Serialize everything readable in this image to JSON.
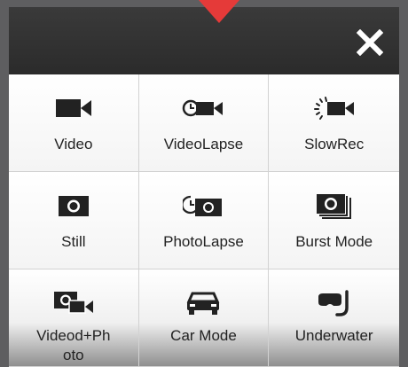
{
  "menu": {
    "close_icon": "close-icon",
    "modes": [
      {
        "id": "video",
        "label": "Video",
        "icon": "video-camera-icon"
      },
      {
        "id": "videolapse",
        "label": "VideoLapse",
        "icon": "videolapse-icon"
      },
      {
        "id": "slowrec",
        "label": "SlowRec",
        "icon": "slow-motion-icon"
      },
      {
        "id": "still",
        "label": "Still",
        "icon": "photo-camera-icon"
      },
      {
        "id": "photolapse",
        "label": "PhotoLapse",
        "icon": "photolapse-icon"
      },
      {
        "id": "burst",
        "label": "Burst Mode",
        "icon": "burst-camera-icon"
      },
      {
        "id": "videophoto",
        "label": "Videod+Ph\noto",
        "icon": "video-photo-icon"
      },
      {
        "id": "carmode",
        "label": "Car Mode",
        "icon": "car-icon"
      },
      {
        "id": "underwater",
        "label": "Underwater",
        "icon": "snorkel-mask-icon"
      }
    ]
  },
  "colors": {
    "accent_pointer": "#e53a39",
    "header_bg": "#2f2f2f",
    "tile_bg": "#ffffff",
    "icon": "#222222"
  }
}
